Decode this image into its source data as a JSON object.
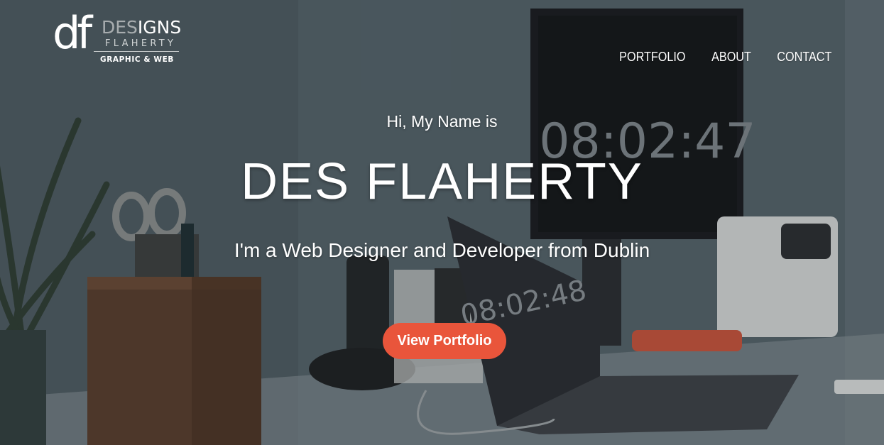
{
  "logo": {
    "df": "df",
    "designs_dim": "DES",
    "designs_bright": "IGNS",
    "flaherty": "FLAHERTY",
    "tagline": "GRAPHIC & WEB"
  },
  "nav": {
    "items": [
      {
        "label": "PORTFOLIO"
      },
      {
        "label": "ABOUT"
      },
      {
        "label": "CONTACT"
      }
    ]
  },
  "hero": {
    "intro": "Hi, My Name is",
    "name": "DES FLAHERTY",
    "tagline": "I'm a Web Designer and Developer from Dublin",
    "cta_label": "View Portfolio",
    "cta_color": "#e9553b"
  },
  "background": {
    "monitor_clock": "08:02:47",
    "laptop_clock": "08:02:48"
  }
}
